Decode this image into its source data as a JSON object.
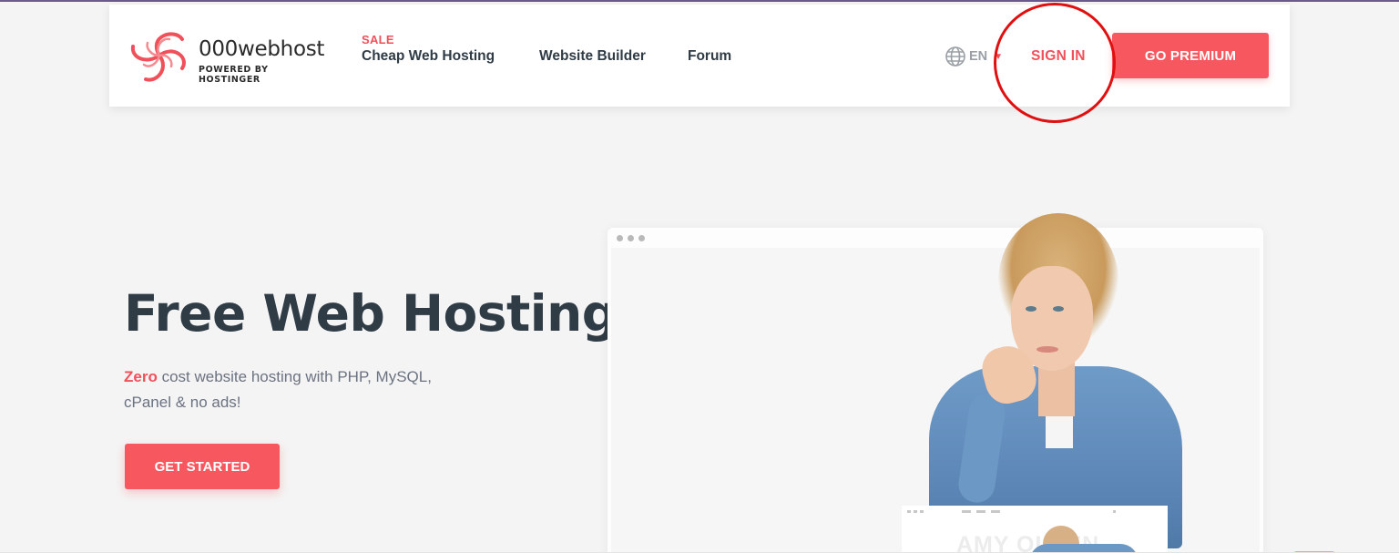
{
  "brand": {
    "name": "000webhost",
    "tagline": "POWERED BY HOSTINGER",
    "colors": {
      "accent": "#f75860",
      "text_dark": "#2f3b45",
      "muted": "#6b7280"
    }
  },
  "nav": {
    "sale_badge": "SALE",
    "items": [
      {
        "label": "Cheap Web Hosting"
      },
      {
        "label": "Website Builder"
      },
      {
        "label": "Forum"
      }
    ],
    "language": {
      "code": "EN",
      "icon": "globe-icon"
    },
    "signin_label": "SIGN IN",
    "premium_label": "GO PREMIUM"
  },
  "hero": {
    "title": "Free Web Hosting",
    "highlight": "Zero",
    "description": " cost website hosting with PHP, MySQL, cPanel & no ads!",
    "cta_label": "GET STARTED"
  },
  "preview": {
    "mini_site_name": "AMY OLSEN"
  }
}
